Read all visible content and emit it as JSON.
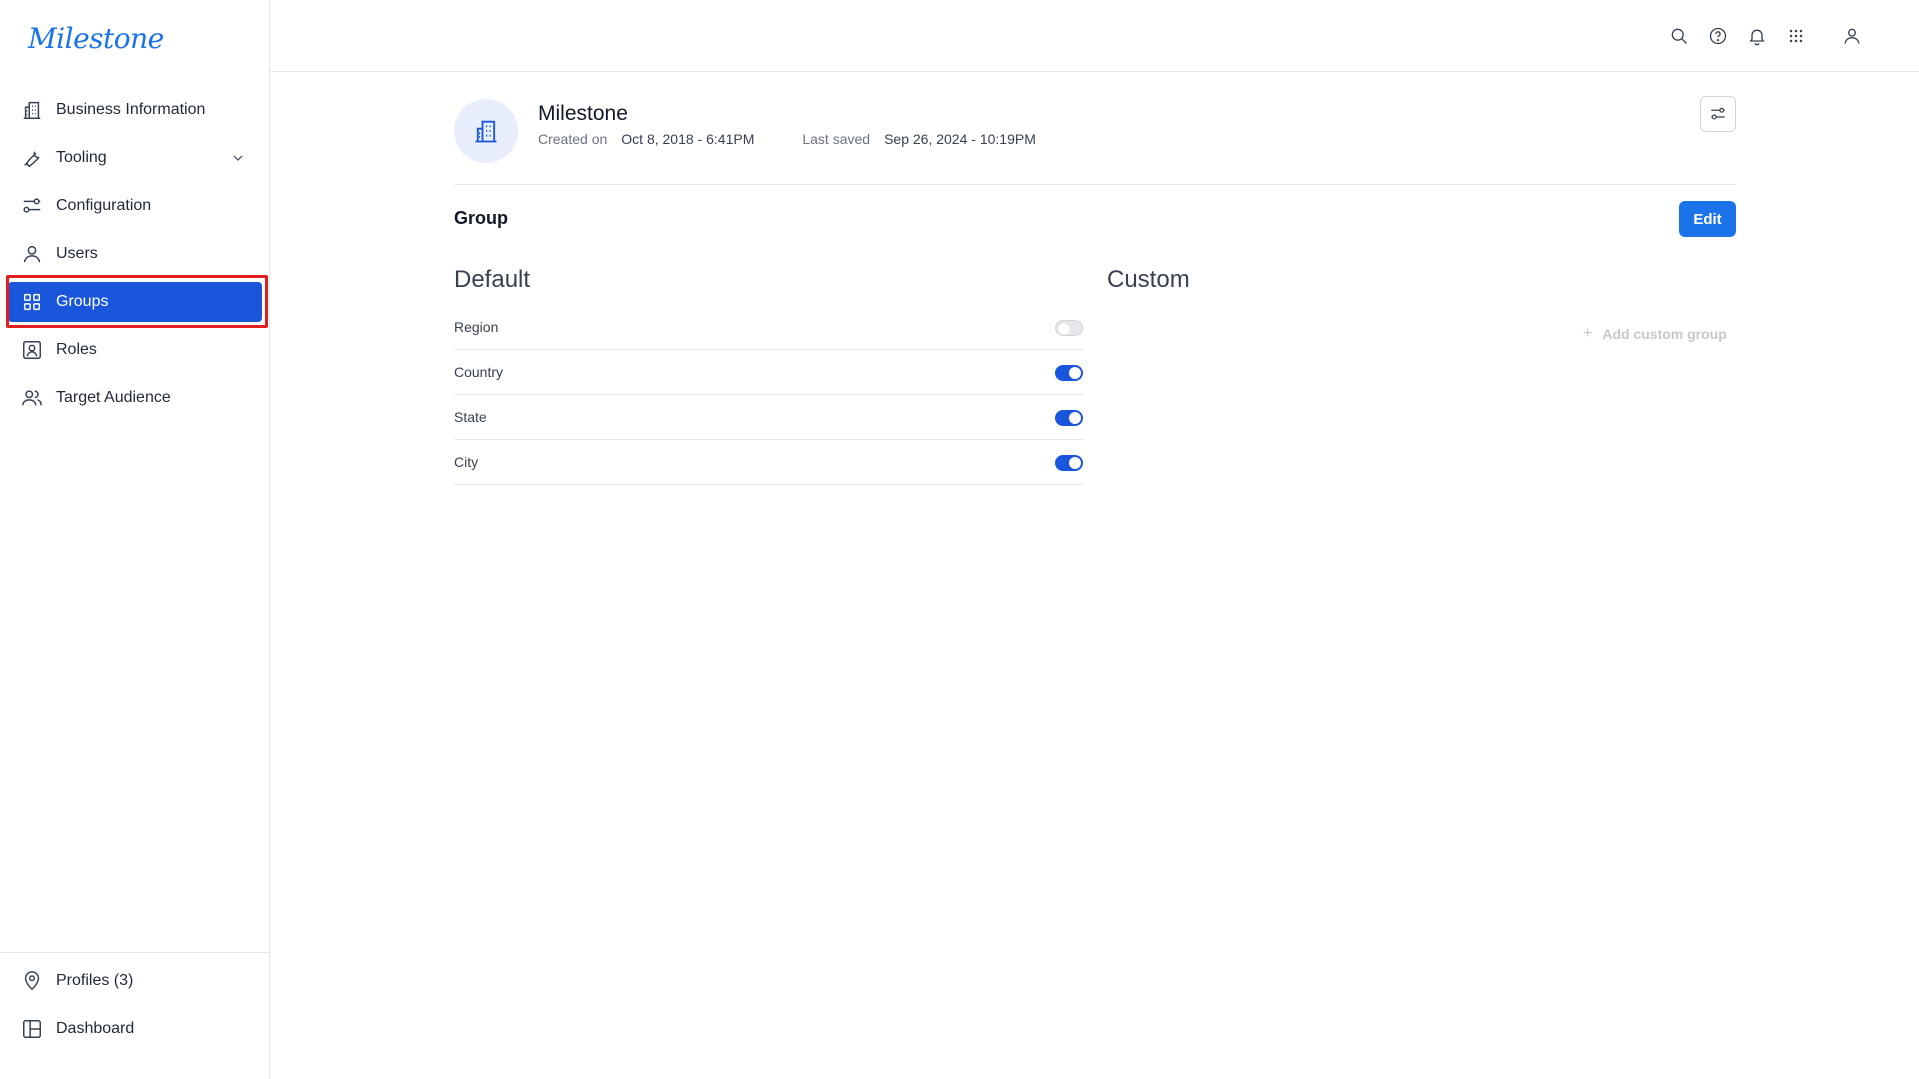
{
  "app": {
    "logo": "Milestone"
  },
  "sidebar": {
    "items": [
      {
        "label": "Business Information",
        "icon": "building-icon"
      },
      {
        "label": "Tooling",
        "icon": "wrench-icon",
        "expandable": true
      },
      {
        "label": "Configuration",
        "icon": "sliders-icon"
      },
      {
        "label": "Users",
        "icon": "user-icon"
      },
      {
        "label": "Groups",
        "icon": "grid-icon",
        "active": true
      },
      {
        "label": "Roles",
        "icon": "id-card-icon"
      },
      {
        "label": "Target Audience",
        "icon": "users-icon"
      }
    ],
    "bottom_items": [
      {
        "label": "Profiles (3)",
        "icon": "location-pin-icon"
      },
      {
        "label": "Dashboard",
        "icon": "layout-icon"
      }
    ]
  },
  "topbar": {
    "icons": [
      "search-icon",
      "help-icon",
      "bell-icon",
      "apps-grid-icon",
      "user-icon"
    ]
  },
  "header": {
    "company_name": "Milestone",
    "created_label": "Created on",
    "created_value": "Oct 8, 2018 - 6:41PM",
    "saved_label": "Last saved",
    "saved_value": "Sep 26, 2024 - 10:19PM"
  },
  "group": {
    "title": "Group",
    "edit_label": "Edit",
    "default_title": "Default",
    "custom_title": "Custom",
    "add_custom_label": "Add custom group",
    "default_items": [
      {
        "label": "Region",
        "enabled": false
      },
      {
        "label": "Country",
        "enabled": true
      },
      {
        "label": "State",
        "enabled": true
      },
      {
        "label": "City",
        "enabled": true
      }
    ]
  },
  "colors": {
    "accent": "#1a56db",
    "button": "#1a73e8",
    "highlight": "#e11d1d"
  }
}
